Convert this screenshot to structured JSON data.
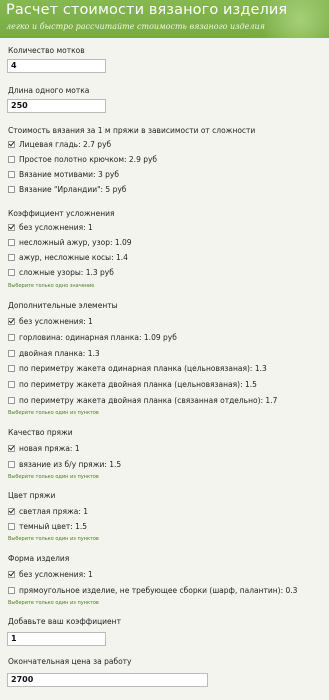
{
  "header": {
    "title": "Расчет стоимости вязаного изделия",
    "subtitle": "легко и быстро рассчитайте стоимость вязаного изделия"
  },
  "fields": {
    "skeins_label": "Количество мотков",
    "skeins_value": "4",
    "length_label": "Длина одного мотка",
    "length_value": "250",
    "coef_label": "Добавьте ваш коэффициент",
    "coef_value": "1",
    "final_label": "Окончательная цена за работу",
    "final_value": "2700"
  },
  "sections": {
    "complexity": {
      "title": "Стоимость вязания за 1 м пряжи в зависимости от сложности",
      "options": [
        {
          "label": "Лицевая гладь: 2.7 руб",
          "checked": true
        },
        {
          "label": "Простое полотно крючком: 2.9 руб",
          "checked": false
        },
        {
          "label": "Вязание мотивами: 3 руб",
          "checked": false
        },
        {
          "label": "Вязание \"Ирландии\": 5 руб",
          "checked": false
        }
      ]
    },
    "difficulty": {
      "title": "Коэффициент усложнения",
      "options": [
        {
          "label": "без усложнения: 1",
          "checked": true
        },
        {
          "label": "несложный ажур, узор: 1.09",
          "checked": false
        },
        {
          "label": "ажур, несложные косы: 1.4",
          "checked": false
        },
        {
          "label": "сложные узоры: 1.3 руб",
          "checked": false
        }
      ],
      "hint": "Выберите только одно значение"
    },
    "extras": {
      "title": "Дополнительные элементы",
      "options": [
        {
          "label": "без усложнения: 1",
          "checked": true
        },
        {
          "label": "горловина: одинарная планка: 1.09 руб",
          "checked": false
        },
        {
          "label": "двойная планка: 1.3",
          "checked": false
        },
        {
          "label": "по периметру жакета одинарная планка (цельновязаная): 1.3",
          "checked": false
        },
        {
          "label": "по периметру жакета двойная планка (цельновязаная): 1.5",
          "checked": false
        },
        {
          "label": "по периметру жакета двойная планка (связанная отдельно): 1.7",
          "checked": false
        }
      ],
      "hint": "Выберите только один из пунктов"
    },
    "quality": {
      "title": "Качество пряжи",
      "options": [
        {
          "label": "новая пряжа: 1",
          "checked": true
        },
        {
          "label": "вязание из б/у пряжи: 1.5",
          "checked": false
        }
      ],
      "hint": "Выберите только один из пунктов"
    },
    "color": {
      "title": "Цвет пряжи",
      "options": [
        {
          "label": "светлая пряжа: 1",
          "checked": true
        },
        {
          "label": "темный цвет: 1.5",
          "checked": false
        }
      ],
      "hint": "Выберите только один из пунктов"
    },
    "shape": {
      "title": "Форма изделия",
      "options": [
        {
          "label": "без усложнения: 1",
          "checked": true
        },
        {
          "label": "прямоугольное изделие, не требующее сборки (шарф, палантин): 0.3",
          "checked": false
        }
      ],
      "hint": "Выберите только один из пунктов"
    }
  },
  "colors": {
    "header_green": "#7fb24a",
    "hint_green": "#4a7d1e",
    "background": "#f4f4ef"
  }
}
